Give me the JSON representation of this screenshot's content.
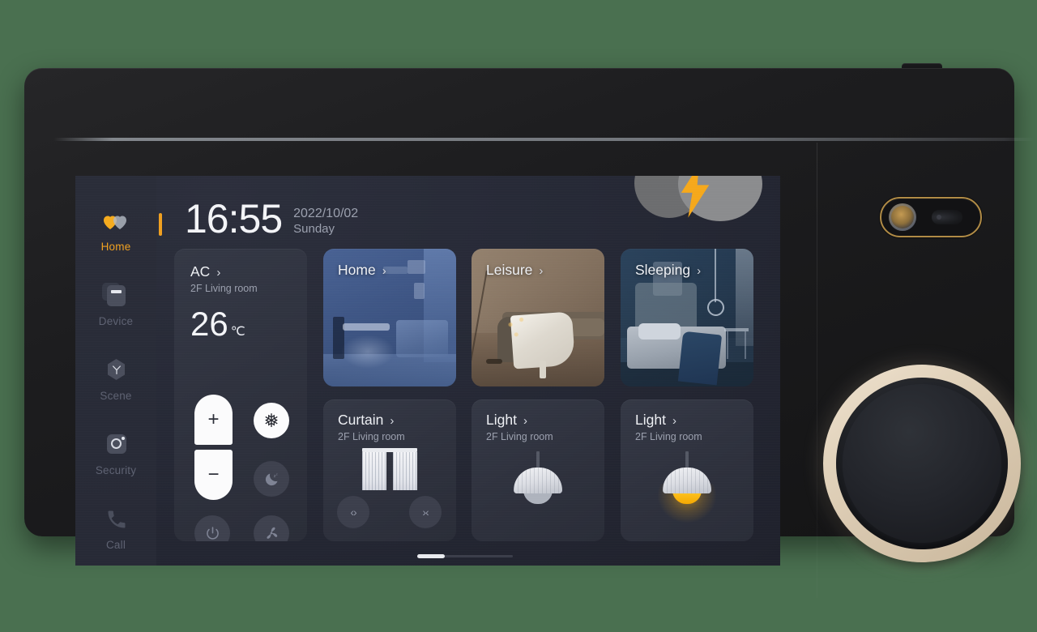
{
  "device": {
    "label": "smart-home-control-panel"
  },
  "sidebar": {
    "items": [
      {
        "label": "Home",
        "icon": "heart-icon",
        "active": true
      },
      {
        "label": "Device",
        "icon": "device-icon",
        "active": false
      },
      {
        "label": "Scene",
        "icon": "scene-icon",
        "active": false
      },
      {
        "label": "Security",
        "icon": "camera-icon",
        "active": false
      },
      {
        "label": "Call",
        "icon": "phone-icon",
        "active": false
      }
    ]
  },
  "header": {
    "time": "16:55",
    "date": "2022/10/02",
    "weekday": "Sunday",
    "weather_icon": "thunderstorm-icon"
  },
  "ac_card": {
    "title": "AC",
    "chevron": "›",
    "room": "2F Living room",
    "temperature": "26",
    "unit": "℃",
    "plus_label": "+",
    "minus_label": "−",
    "modes": [
      {
        "name": "cool-mode-button",
        "icon": "snowflake-icon",
        "glyph": "❅",
        "active": true
      },
      {
        "name": "sleep-mode-button",
        "icon": "moon-icon",
        "glyph": "☾",
        "active": false
      },
      {
        "name": "power-button",
        "icon": "power-icon",
        "glyph": "⏻",
        "active": false
      },
      {
        "name": "fan-button",
        "icon": "fan-icon",
        "glyph": "❃",
        "active": false
      }
    ]
  },
  "scenes": [
    {
      "title": "Home",
      "chevron": "›",
      "art": "living-room"
    },
    {
      "title": "Leisure",
      "chevron": "›",
      "art": "lounge-room"
    },
    {
      "title": "Sleeping",
      "chevron": "›",
      "art": "bedroom"
    }
  ],
  "curtain_card": {
    "title": "Curtain",
    "chevron": "›",
    "room": "2F Living room",
    "open_label": "‹›",
    "close_label": "›‹",
    "state": "open"
  },
  "light_cards": [
    {
      "title": "Light",
      "chevron": "›",
      "room": "2F Living room",
      "state": "off"
    },
    {
      "title": "Light",
      "chevron": "›",
      "room": "2F Living room",
      "state": "on"
    }
  ],
  "pager": {
    "page": "1",
    "total": "3"
  },
  "hardware": {
    "camera_label": "camera-module",
    "dial_label": "rotary-dial"
  },
  "colors": {
    "background": "#4a7050",
    "accent": "#f0a020",
    "screen_bg": "#272a36",
    "card_bg": "#2f323e",
    "dial_ring": "#e2d3bc",
    "light_on": "#f4a800"
  }
}
